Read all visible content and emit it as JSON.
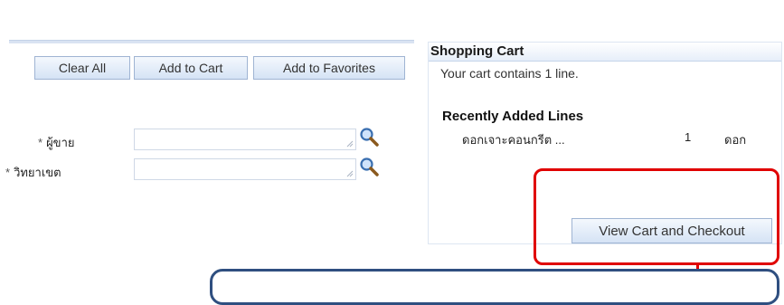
{
  "toolbar": {
    "clear_all": "Clear All",
    "add_to_cart": "Add to Cart",
    "add_to_favorites": "Add to Favorites"
  },
  "form": {
    "required_mark": "*",
    "field1_label": "ผู้ขาย",
    "field2_label": "วิทยาเขต",
    "field1_value": "",
    "field2_value": ""
  },
  "cart": {
    "title": "Shopping Cart",
    "count_text": "Your cart contains 1 line.",
    "recent_heading": "Recently Added Lines",
    "recent_items": [
      {
        "name": "ดอกเจาะคอนกรีต ...",
        "qty": "1",
        "unit": "ดอก"
      }
    ],
    "checkout_label": "View Cart and Checkout"
  },
  "icons": {
    "search": "magnifier-icon",
    "resize": "resize-grip-icon"
  },
  "colors": {
    "highlight": "#e00000",
    "callout_border": "#2f4f80",
    "button_border": "#9fb4d3"
  }
}
